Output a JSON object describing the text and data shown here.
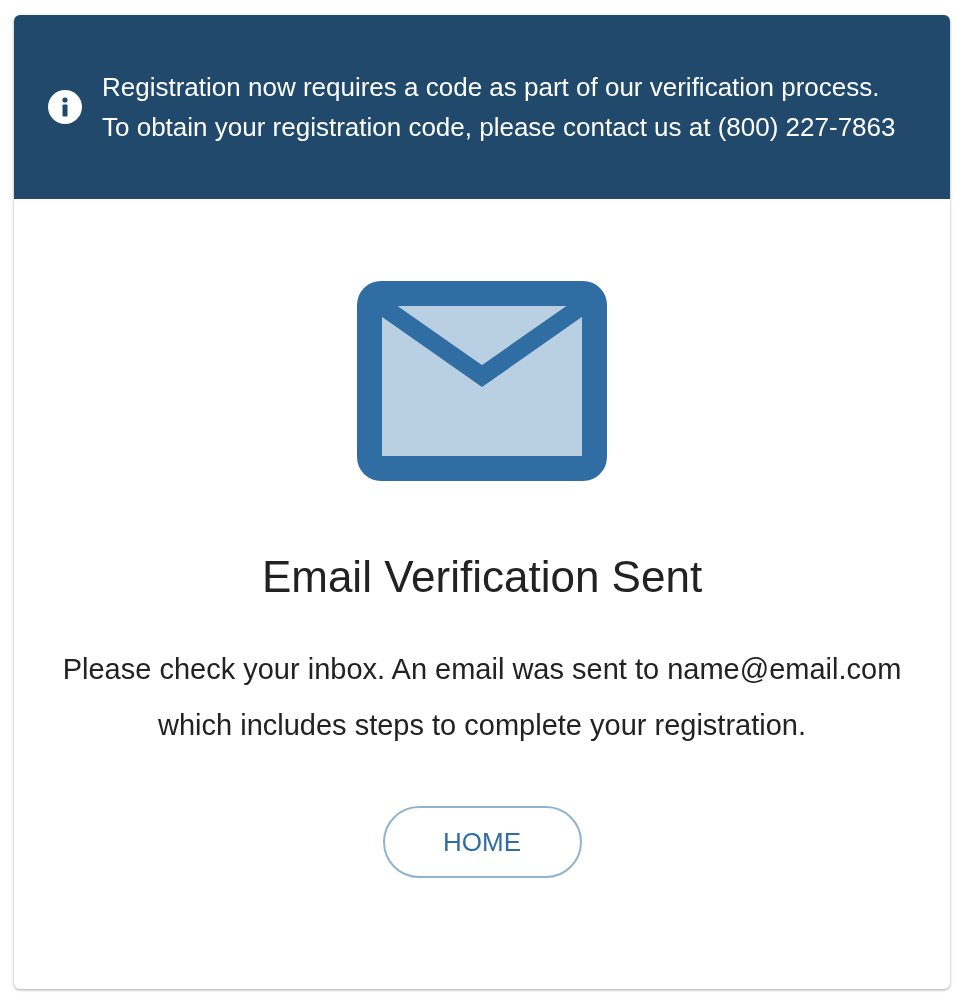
{
  "notice": {
    "text": "Registration now requires a code as part of our verification process. To obtain your registration code, please contact us at (800) 227-7863"
  },
  "title": "Email Verification Sent",
  "message": "Please check your inbox. An email was sent to name@email.com which includes steps to complete your registration.",
  "button": "HOME"
}
